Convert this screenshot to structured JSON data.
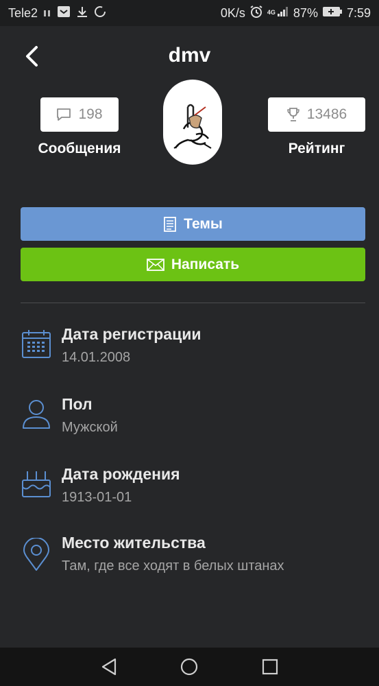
{
  "status_bar": {
    "carrier": "Tele2",
    "net_speed": "0K/s",
    "network_type": "4G",
    "battery": "87%",
    "time": "7:59"
  },
  "profile": {
    "username": "dmv",
    "messages_count": "198",
    "messages_label": "Сообщения",
    "rating_count": "13486",
    "rating_label": "Рейтинг"
  },
  "actions": {
    "topics_label": "Темы",
    "write_label": "Написать"
  },
  "info": [
    {
      "icon": "calendar-icon",
      "label": "Дата регистрации",
      "value": "14.01.2008"
    },
    {
      "icon": "person-icon",
      "label": "Пол",
      "value": "Мужской"
    },
    {
      "icon": "cake-icon",
      "label": "Дата рождения",
      "value": "1913-01-01"
    },
    {
      "icon": "location-pin-icon",
      "label": "Место жительства",
      "value": "Там, где все ходят в белых штанах"
    }
  ],
  "colors": {
    "background": "#262729",
    "topics_button": "#6a97d3",
    "write_button": "#6cc214",
    "icon_accent": "#5b8fd1"
  }
}
